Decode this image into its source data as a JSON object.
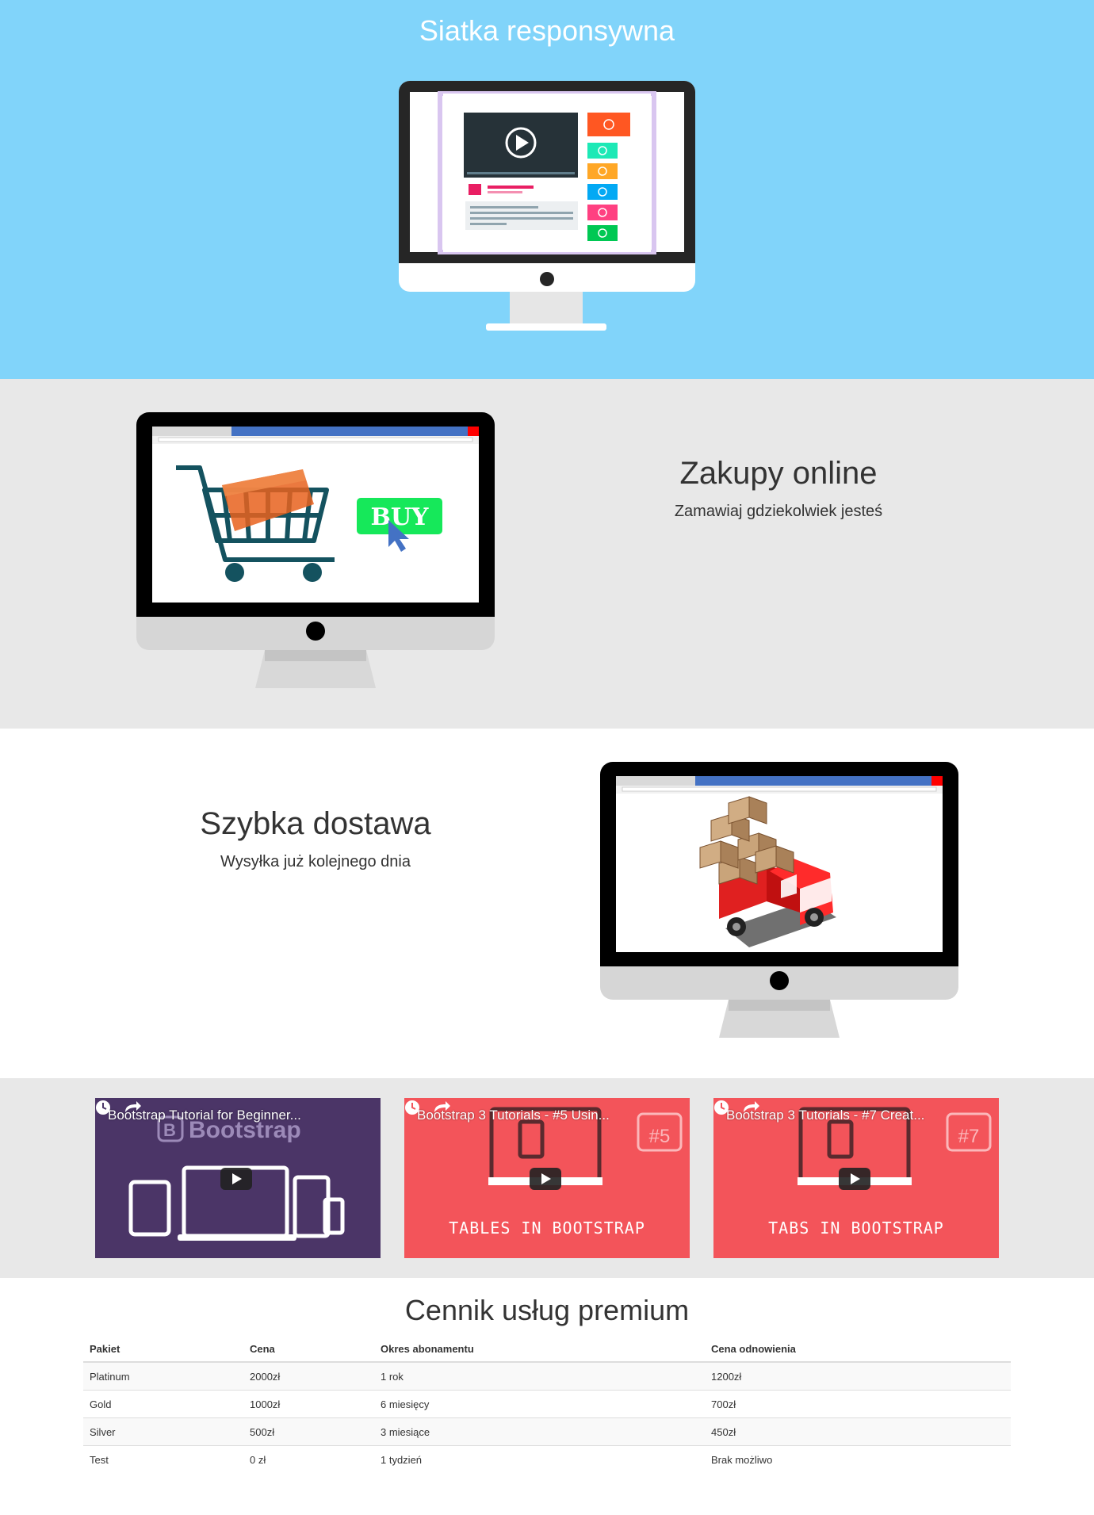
{
  "hero": {
    "title": "Siatka responsywna"
  },
  "shop": {
    "title": "Zakupy online",
    "subtitle": "Zamawiaj gdziekolwiek jesteś",
    "buy_label": "BUY"
  },
  "delivery": {
    "title": "Szybka dostawa",
    "subtitle": "Wysyłka już kolejnego dnia"
  },
  "videos": [
    {
      "title": "Bootstrap Tutorial for Beginner...",
      "logo_text": "Bootstrap",
      "caption": "",
      "bg": "#4b3567"
    },
    {
      "title": "Bootstrap 3 Tutorials - #5 Usin...",
      "badge": "#5",
      "caption": "TABLES IN BOOTSTRAP",
      "bg": "#f3545a"
    },
    {
      "title": "Bootstrap 3 Tutorials - #7 Creat...",
      "badge": "#7",
      "caption": "TABS IN BOOTSTRAP",
      "bg": "#f3545a"
    }
  ],
  "pricing": {
    "title": "Cennik usług premium",
    "headers": [
      "Pakiet",
      "Cena",
      "Okres abonamentu",
      "Cena odnowienia"
    ],
    "rows": [
      [
        "Platinum",
        "2000zł",
        "1 rok",
        "1200zł"
      ],
      [
        "Gold",
        "1000zł",
        "6 miesięcy",
        "700zł"
      ],
      [
        "Silver",
        "500zł",
        "3 miesiące",
        "450zł"
      ],
      [
        "Test",
        "0 zł",
        "1 tydzień",
        "Brak możliwo"
      ]
    ]
  },
  "colors": {
    "hero_bg": "#81d4fa",
    "band_bg": "#e8e8e8",
    "buy_green": "#16e85a",
    "cart_teal": "#14525f",
    "video_purple": "#4b3567",
    "video_red": "#f3545a"
  }
}
